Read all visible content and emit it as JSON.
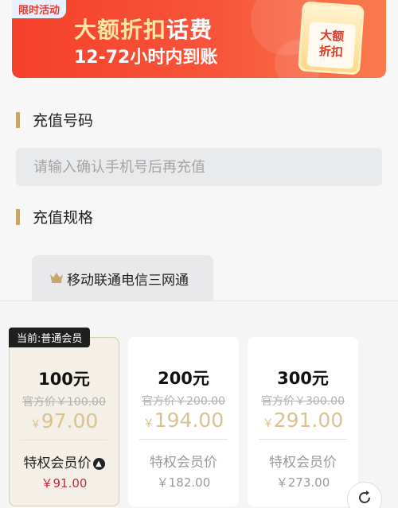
{
  "banner": {
    "tag": "限时活动",
    "title_a": "大额折扣",
    "title_b": "话费",
    "subtitle": "12-72小时内到账",
    "phone_text_1": "大额",
    "phone_text_2": "折扣"
  },
  "sections": {
    "number_title": "充值号码",
    "spec_title": "充值规格"
  },
  "input": {
    "placeholder": "请输入确认手机号后再充值"
  },
  "carrier_chip": "移动联通电信三网通",
  "member_badge": "当前:普通会员",
  "cards": [
    {
      "amount": "100元",
      "official": "官方价￥100.00",
      "yen": "￥",
      "price": "97.00",
      "vip_label": "特权会员价",
      "vip_price": "￥91.00"
    },
    {
      "amount": "200元",
      "official": "官方价￥200.00",
      "yen": "￥",
      "price": "194.00",
      "vip_label": "特权会员价",
      "vip_price": "￥182.00"
    },
    {
      "amount": "300元",
      "official": "官方价￥300.00",
      "yen": "￥",
      "price": "291.00",
      "vip_label": "特权会员价",
      "vip_price": "￥273.00"
    }
  ],
  "colors": {
    "accent_gold": "#c8a56a",
    "banner_red": "#f5402a",
    "vip_price_red": "#c8283a"
  },
  "icons": {
    "crown": "crown-icon",
    "upgrade": "arrow-up-circle-icon",
    "refresh": "refresh-icon"
  }
}
